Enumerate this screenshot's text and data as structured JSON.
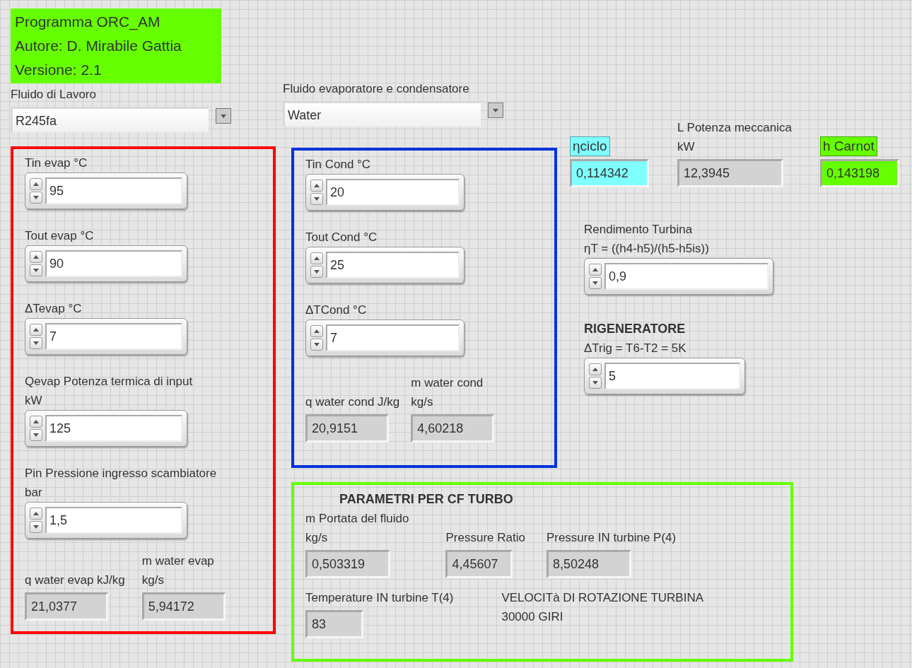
{
  "header": {
    "lines": [
      "Programma ORC_AM",
      "Autore: D. Mirabile Gattia",
      "Versione: 2.1"
    ]
  },
  "working_fluid": {
    "label": "Fluido di Lavoro",
    "value": "R245fa"
  },
  "exchanger_fluid": {
    "label": "Fluido evaporatore e condensatore",
    "value": "Water"
  },
  "evaporator": {
    "controls": [
      {
        "label": [
          "Tin evap °C"
        ],
        "value": "95"
      },
      {
        "label": [
          "Tout evap °C"
        ],
        "value": "90"
      },
      {
        "label": [
          "ΔTevap °C"
        ],
        "value": "7"
      },
      {
        "label": [
          "Qevap Potenza termica di input",
          "kW"
        ],
        "value": "125"
      },
      {
        "label": [
          "Pin Pressione ingresso scambiatore",
          "bar"
        ],
        "value": "1,5"
      }
    ],
    "indicators": [
      {
        "label": [
          "q water evap kJ/kg"
        ],
        "value": "21,0377"
      },
      {
        "label": [
          "m water evap",
          "kg/s"
        ],
        "value": "5,94172"
      }
    ]
  },
  "condenser": {
    "controls": [
      {
        "label": [
          "Tin Cond °C"
        ],
        "value": "20"
      },
      {
        "label": [
          "Tout Cond °C"
        ],
        "value": "25"
      },
      {
        "label": [
          "ΔTCond °C"
        ],
        "value": "7"
      }
    ],
    "indicators": [
      {
        "label": [
          "q water cond J/kg"
        ],
        "value": "20,9151"
      },
      {
        "label": [
          "m water cond",
          "kg/s"
        ],
        "value": "4,60218"
      }
    ]
  },
  "results": [
    {
      "label": [
        "ηciclo"
      ],
      "value": "0,114342",
      "color": "#80ffff"
    },
    {
      "label": [
        "L Potenza meccanica",
        "kW"
      ],
      "value": "12,3945"
    },
    {
      "label": [
        "h Carnot"
      ],
      "value": "0,143198",
      "color": "#66ff00"
    }
  ],
  "turbine_efficiency": {
    "label": [
      "Rendimento Turbina",
      "ηT =  ((h4-h5)/(h5-h5is))"
    ],
    "value": "0,9"
  },
  "regenerator": {
    "title": "RIGENERATORE",
    "label": [
      "ΔTrig = T6-T2 = 5K"
    ],
    "value": "5"
  },
  "cf_turbo": {
    "title": "PARAMETRI PER CF TURBO",
    "indicators": [
      {
        "label": [
          "m Portata del fluido",
          "kg/s"
        ],
        "value": "0,503319"
      },
      {
        "label": [
          "Pressure Ratio"
        ],
        "value": "4,45607"
      },
      {
        "label": [
          "Pressure IN turbine P(4)"
        ],
        "value": "8,50248"
      },
      {
        "label": [
          "Temperature IN turbine T(4)"
        ],
        "value": "83"
      }
    ],
    "note": [
      "VELOCITà DI ROTAZIONE TURBINA",
      "30000 GIRI"
    ]
  }
}
